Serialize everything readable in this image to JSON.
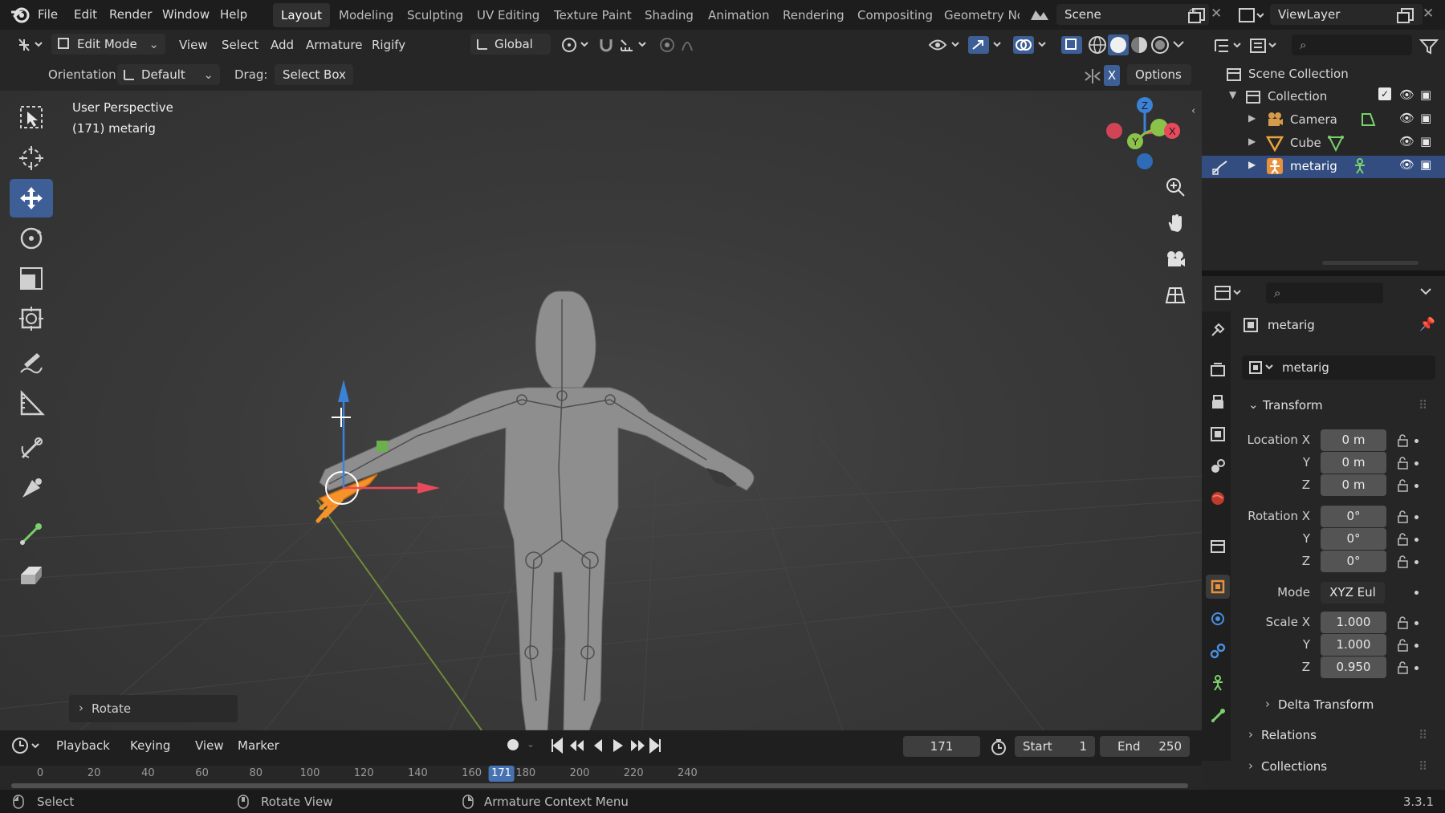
{
  "topbar": {
    "menus": [
      "File",
      "Edit",
      "Render",
      "Window",
      "Help"
    ],
    "workspaces": [
      "Layout",
      "Modeling",
      "Sculpting",
      "UV Editing",
      "Texture Paint",
      "Shading",
      "Animation",
      "Rendering",
      "Compositing",
      "Geometry Nc"
    ],
    "active_workspace": "Layout",
    "scene": "Scene",
    "view_layer": "ViewLayer"
  },
  "header": {
    "mode": "Edit Mode",
    "menus": [
      "View",
      "Select",
      "Add",
      "Armature",
      "Rigify"
    ],
    "transform_orientation": "Global",
    "orientation_label": "Orientation:",
    "orientation_value": "Default",
    "drag_label": "Drag:",
    "drag_value": "Select Box",
    "options_label": "Options",
    "x_mirror": "X"
  },
  "viewport": {
    "perspective_label": "User Perspective",
    "object_label": "(171) metarig",
    "last_operator": "Rotate",
    "gizmo_axes": [
      "X",
      "Y",
      "Z"
    ]
  },
  "outliner": {
    "root": "Scene Collection",
    "collection": "Collection",
    "items": [
      {
        "name": "Camera",
        "icon": "camera-object-icon",
        "color": "#d59a4a",
        "data_icon": "camera-data-icon",
        "data_color": "#7ad06b"
      },
      {
        "name": "Cube",
        "icon": "mesh-object-icon",
        "color": "#e8a33d",
        "data_icon": "mesh-data-icon",
        "data_color": "#7ad06b"
      },
      {
        "name": "metarig",
        "icon": "armature-object-icon",
        "color": "#e8913d",
        "data_icon": "armature-data-icon",
        "data_color": "#7ad06b",
        "selected": true
      }
    ]
  },
  "properties": {
    "object_name": "metarig",
    "datablock_name": "metarig",
    "transform_title": "Transform",
    "location_label": "Location X",
    "rotation_label": "Rotation X",
    "scale_label": "Scale X",
    "axis_y": "Y",
    "axis_z": "Z",
    "location": [
      "0 m",
      "0 m",
      "0 m"
    ],
    "rotation": [
      "0°",
      "0°",
      "0°"
    ],
    "mode_label": "Mode",
    "mode_value": "XYZ Eul",
    "scale": [
      "1.000",
      "1.000",
      "0.950"
    ],
    "delta_transform": "Delta Transform",
    "relations": "Relations",
    "collections": "Collections"
  },
  "timeline": {
    "menus": [
      "Playback",
      "Keying",
      "View",
      "Marker"
    ],
    "current_frame": "171",
    "start_label": "Start",
    "start": "1",
    "end_label": "End",
    "end": "250",
    "ticks": [
      "0",
      "20",
      "40",
      "60",
      "80",
      "100",
      "120",
      "140",
      "160",
      "180",
      "200",
      "220",
      "240"
    ],
    "playhead": "171"
  },
  "status": {
    "select": "Select",
    "rotate_view": "Rotate View",
    "context_menu": "Armature Context Menu",
    "version": "3.3.1"
  },
  "colors": {
    "accent": "#3d5f96",
    "selected_row": "#334d80",
    "x_axis": "#e84a5c",
    "y_axis": "#8bc34a",
    "z_axis": "#3b82d6",
    "armature_orange": "#f5932a"
  }
}
